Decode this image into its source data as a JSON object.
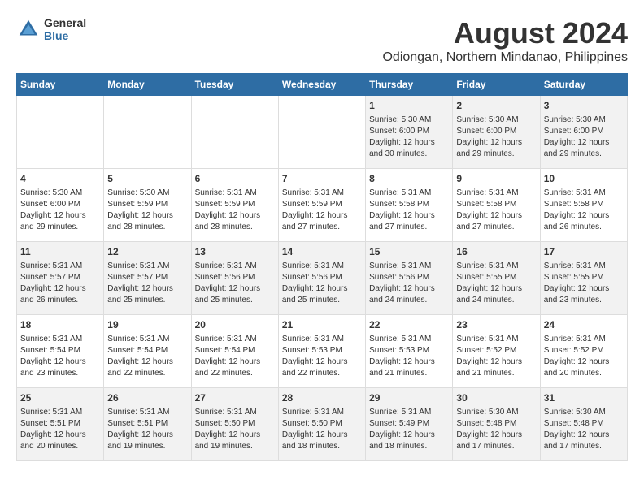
{
  "logo": {
    "general": "General",
    "blue": "Blue"
  },
  "title": "August 2024",
  "subtitle": "Odiongan, Northern Mindanao, Philippines",
  "days_header": [
    "Sunday",
    "Monday",
    "Tuesday",
    "Wednesday",
    "Thursday",
    "Friday",
    "Saturday"
  ],
  "weeks": [
    [
      {
        "day": "",
        "info": ""
      },
      {
        "day": "",
        "info": ""
      },
      {
        "day": "",
        "info": ""
      },
      {
        "day": "",
        "info": ""
      },
      {
        "day": "1",
        "info": "Sunrise: 5:30 AM\nSunset: 6:00 PM\nDaylight: 12 hours\nand 30 minutes."
      },
      {
        "day": "2",
        "info": "Sunrise: 5:30 AM\nSunset: 6:00 PM\nDaylight: 12 hours\nand 29 minutes."
      },
      {
        "day": "3",
        "info": "Sunrise: 5:30 AM\nSunset: 6:00 PM\nDaylight: 12 hours\nand 29 minutes."
      }
    ],
    [
      {
        "day": "4",
        "info": "Sunrise: 5:30 AM\nSunset: 6:00 PM\nDaylight: 12 hours\nand 29 minutes."
      },
      {
        "day": "5",
        "info": "Sunrise: 5:30 AM\nSunset: 5:59 PM\nDaylight: 12 hours\nand 28 minutes."
      },
      {
        "day": "6",
        "info": "Sunrise: 5:31 AM\nSunset: 5:59 PM\nDaylight: 12 hours\nand 28 minutes."
      },
      {
        "day": "7",
        "info": "Sunrise: 5:31 AM\nSunset: 5:59 PM\nDaylight: 12 hours\nand 27 minutes."
      },
      {
        "day": "8",
        "info": "Sunrise: 5:31 AM\nSunset: 5:58 PM\nDaylight: 12 hours\nand 27 minutes."
      },
      {
        "day": "9",
        "info": "Sunrise: 5:31 AM\nSunset: 5:58 PM\nDaylight: 12 hours\nand 27 minutes."
      },
      {
        "day": "10",
        "info": "Sunrise: 5:31 AM\nSunset: 5:58 PM\nDaylight: 12 hours\nand 26 minutes."
      }
    ],
    [
      {
        "day": "11",
        "info": "Sunrise: 5:31 AM\nSunset: 5:57 PM\nDaylight: 12 hours\nand 26 minutes."
      },
      {
        "day": "12",
        "info": "Sunrise: 5:31 AM\nSunset: 5:57 PM\nDaylight: 12 hours\nand 25 minutes."
      },
      {
        "day": "13",
        "info": "Sunrise: 5:31 AM\nSunset: 5:56 PM\nDaylight: 12 hours\nand 25 minutes."
      },
      {
        "day": "14",
        "info": "Sunrise: 5:31 AM\nSunset: 5:56 PM\nDaylight: 12 hours\nand 25 minutes."
      },
      {
        "day": "15",
        "info": "Sunrise: 5:31 AM\nSunset: 5:56 PM\nDaylight: 12 hours\nand 24 minutes."
      },
      {
        "day": "16",
        "info": "Sunrise: 5:31 AM\nSunset: 5:55 PM\nDaylight: 12 hours\nand 24 minutes."
      },
      {
        "day": "17",
        "info": "Sunrise: 5:31 AM\nSunset: 5:55 PM\nDaylight: 12 hours\nand 23 minutes."
      }
    ],
    [
      {
        "day": "18",
        "info": "Sunrise: 5:31 AM\nSunset: 5:54 PM\nDaylight: 12 hours\nand 23 minutes."
      },
      {
        "day": "19",
        "info": "Sunrise: 5:31 AM\nSunset: 5:54 PM\nDaylight: 12 hours\nand 22 minutes."
      },
      {
        "day": "20",
        "info": "Sunrise: 5:31 AM\nSunset: 5:54 PM\nDaylight: 12 hours\nand 22 minutes."
      },
      {
        "day": "21",
        "info": "Sunrise: 5:31 AM\nSunset: 5:53 PM\nDaylight: 12 hours\nand 22 minutes."
      },
      {
        "day": "22",
        "info": "Sunrise: 5:31 AM\nSunset: 5:53 PM\nDaylight: 12 hours\nand 21 minutes."
      },
      {
        "day": "23",
        "info": "Sunrise: 5:31 AM\nSunset: 5:52 PM\nDaylight: 12 hours\nand 21 minutes."
      },
      {
        "day": "24",
        "info": "Sunrise: 5:31 AM\nSunset: 5:52 PM\nDaylight: 12 hours\nand 20 minutes."
      }
    ],
    [
      {
        "day": "25",
        "info": "Sunrise: 5:31 AM\nSunset: 5:51 PM\nDaylight: 12 hours\nand 20 minutes."
      },
      {
        "day": "26",
        "info": "Sunrise: 5:31 AM\nSunset: 5:51 PM\nDaylight: 12 hours\nand 19 minutes."
      },
      {
        "day": "27",
        "info": "Sunrise: 5:31 AM\nSunset: 5:50 PM\nDaylight: 12 hours\nand 19 minutes."
      },
      {
        "day": "28",
        "info": "Sunrise: 5:31 AM\nSunset: 5:50 PM\nDaylight: 12 hours\nand 18 minutes."
      },
      {
        "day": "29",
        "info": "Sunrise: 5:31 AM\nSunset: 5:49 PM\nDaylight: 12 hours\nand 18 minutes."
      },
      {
        "day": "30",
        "info": "Sunrise: 5:30 AM\nSunset: 5:48 PM\nDaylight: 12 hours\nand 17 minutes."
      },
      {
        "day": "31",
        "info": "Sunrise: 5:30 AM\nSunset: 5:48 PM\nDaylight: 12 hours\nand 17 minutes."
      }
    ]
  ]
}
